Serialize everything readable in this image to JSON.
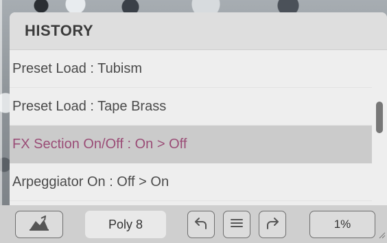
{
  "history": {
    "title": "HISTORY",
    "items": [
      {
        "label": "Preset Load : Tubism"
      },
      {
        "label": "Preset Load : Tape Brass"
      },
      {
        "label": "FX Section On/Off : On > Off"
      },
      {
        "label": "Arpeggiator On : Off > On"
      }
    ],
    "selected_index": 2
  },
  "footer": {
    "left_icon": "synth-shape-icon",
    "poly_label": "Poly 8",
    "undo_icon": "undo-icon",
    "history_icon": "menu-icon",
    "redo_icon": "redo-icon",
    "cpu_label": "1%"
  },
  "colors": {
    "panel_bg": "#eeeeee",
    "header_bg": "#dedede",
    "selected_bg": "#cbcbcb",
    "selected_text": "#9a4c76",
    "footer_bg": "#cfcfcf"
  }
}
